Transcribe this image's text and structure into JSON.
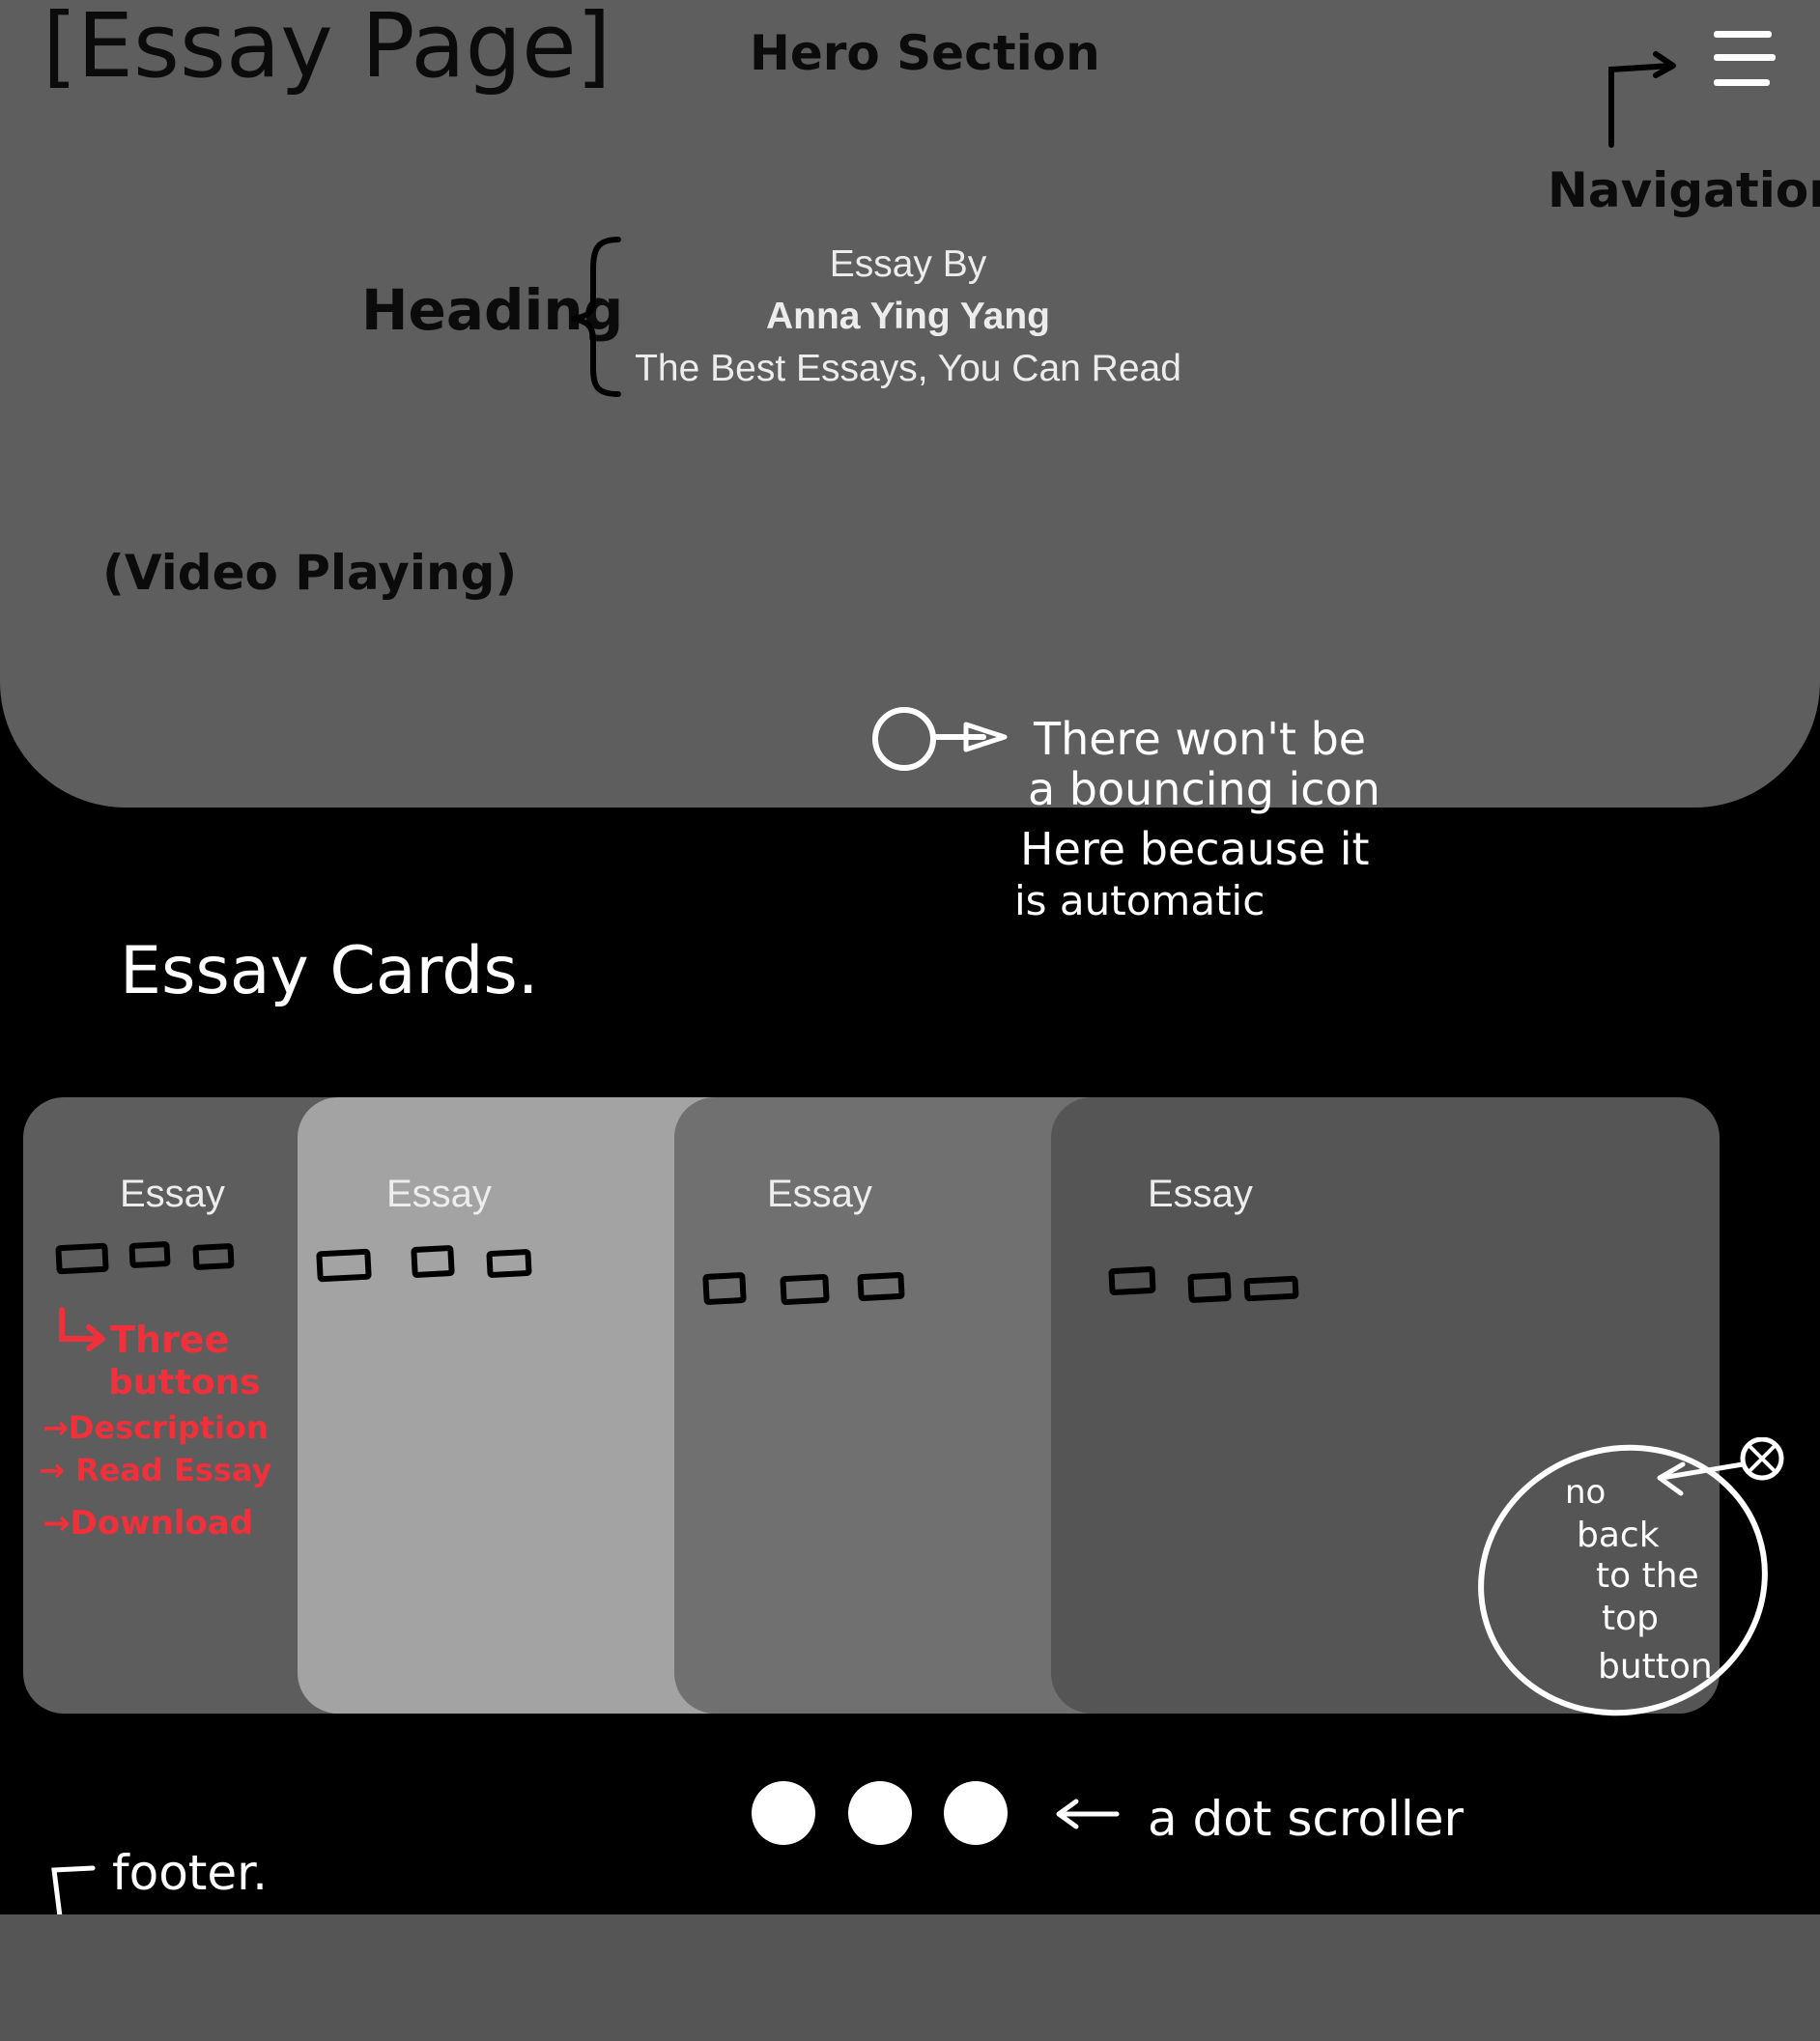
{
  "colors": {
    "page_background": "#000000",
    "hero_background": "#5e5e5e",
    "footer_background": "#555555",
    "card_1": "#5d5d5d",
    "card_2": "#a3a3a3",
    "card_3": "#707070",
    "card_4": "#555555",
    "annotation_red": "#f0303a"
  },
  "annotations": {
    "page_title": "[Essay Page]",
    "hero_section": "Hero Section",
    "navigation": "Navigation",
    "heading": "Heading",
    "video_playing": "(Video Playing)",
    "bouncing_icon_note": [
      "There won't be",
      "a bouncing icon",
      "Here because it",
      "is automatic"
    ],
    "essay_cards": "Essay Cards.",
    "three_buttons_note": [
      "Three",
      "buttons",
      "Description",
      "Read Essay",
      "Download"
    ],
    "no_back_to_top_note": [
      "no",
      "back",
      "to the",
      "top",
      "button"
    ],
    "dot_scroller": "a dot scroller",
    "footer": "footer."
  },
  "hero": {
    "heading_lines": [
      "Essay By",
      "Anna Ying Yang",
      "The Best Essays, You Can Read"
    ],
    "menu_icon": "hamburger-menu-icon"
  },
  "cards": [
    {
      "title": "Essay"
    },
    {
      "title": "Essay"
    },
    {
      "title": "Essay"
    },
    {
      "title": "Essay"
    }
  ],
  "dot_scroller": {
    "dots": 3
  }
}
